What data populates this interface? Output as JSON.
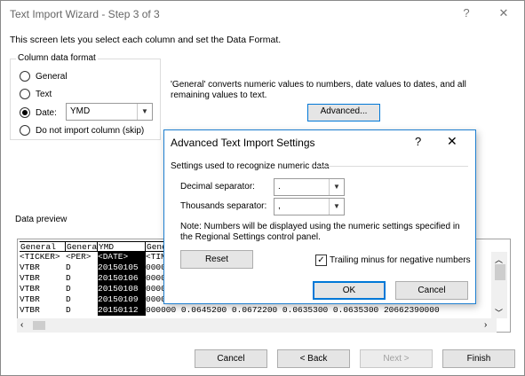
{
  "window": {
    "title": "Text Import Wizard - Step 3 of 3",
    "help_glyph": "?",
    "close_glyph": "✕"
  },
  "description": "This screen lets you select each column and set the Data Format.",
  "column_data_format": {
    "label": "Column data format",
    "options": [
      "General",
      "Text",
      "Date:",
      "Do not import column (skip)"
    ],
    "selected": "Date:",
    "date_format": "YMD"
  },
  "general_info": "'General' converts numeric values to numbers, date values to dates, and all remaining values to text.",
  "advanced_button": "Advanced...",
  "data_preview": {
    "label": "Data preview",
    "headers": [
      "General",
      "Genera",
      "YMD",
      "Gene"
    ],
    "rows": [
      [
        "<TICKER>",
        "<PER>",
        "<DATE>",
        "<TIM"
      ],
      [
        "VTBR",
        "D",
        "20150105",
        "0000"
      ],
      [
        "VTBR",
        "D",
        "20150106",
        "0000"
      ],
      [
        "VTBR",
        "D",
        "20150108",
        "0000"
      ],
      [
        "VTBR",
        "D",
        "20150109",
        "0000"
      ],
      [
        "VTBR",
        "D",
        "20150112",
        "000000 0.0645200 0.0672200 0.0635300 0.0635300 20662390000"
      ]
    ]
  },
  "footer": {
    "cancel": "Cancel",
    "back": "< Back",
    "next": "Next >",
    "finish": "Finish"
  },
  "advanced_dialog": {
    "title": "Advanced Text Import Settings",
    "help_glyph": "?",
    "close_glyph": "✕",
    "section_label": "Settings used to recognize numeric data",
    "decimal_label": "Decimal separator:",
    "decimal_value": ".",
    "thousands_label": "Thousands separator:",
    "thousands_value": ",",
    "note": "Note: Numbers will be displayed using the numeric settings specified in the Regional Settings control panel.",
    "reset": "Reset",
    "trailing_minus_label": "Trailing minus for negative numbers",
    "trailing_minus_checked": true,
    "ok": "OK",
    "cancel": "Cancel"
  },
  "colors": {
    "focus_blue": "#0078d7",
    "dialog_border": "#1e7fd0",
    "button_face": "#e5e5e5"
  }
}
